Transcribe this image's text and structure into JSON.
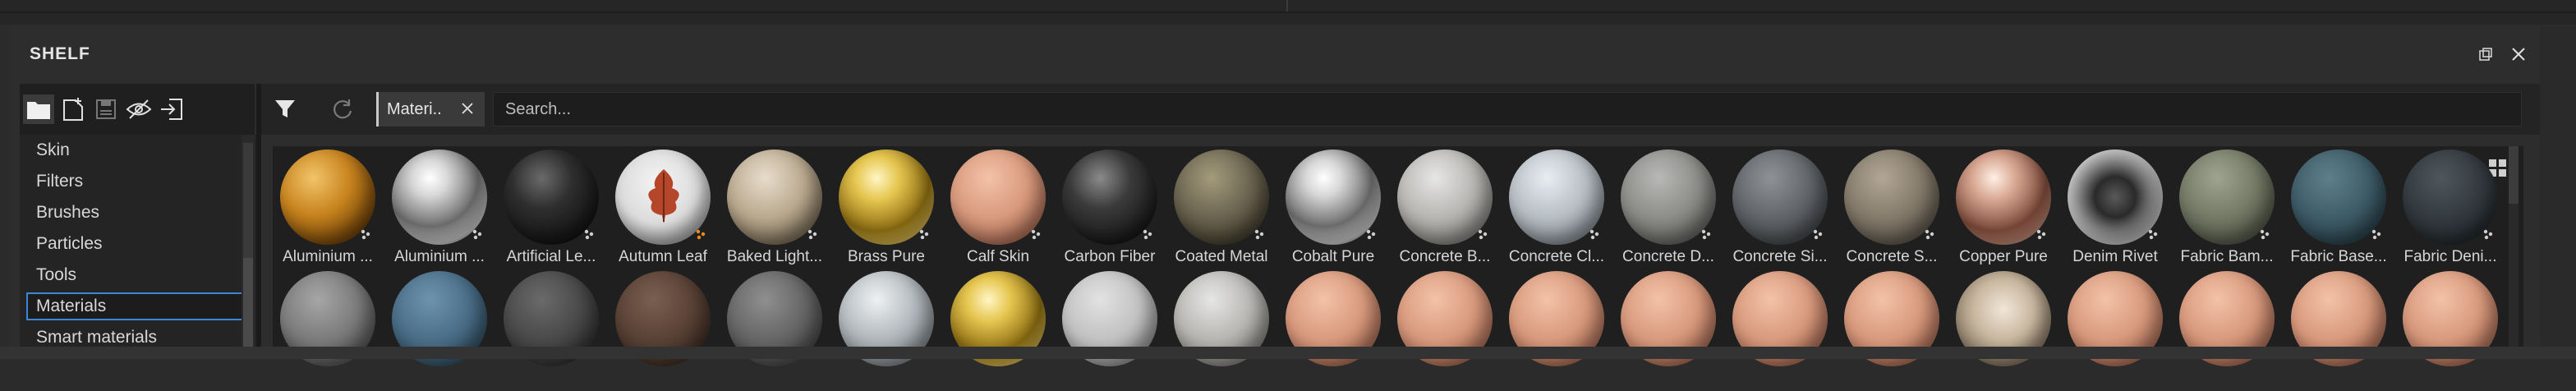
{
  "panel": {
    "title": "SHELF",
    "buttons": {
      "float": "float-window-icon",
      "close": "close-icon"
    }
  },
  "toolbar": {
    "icons": [
      "folder-icon",
      "new-resource-icon",
      "save-icon",
      "hide-icon",
      "import-icon"
    ]
  },
  "categories": {
    "items": [
      {
        "label": "Skin"
      },
      {
        "label": "Filters"
      },
      {
        "label": "Brushes"
      },
      {
        "label": "Particles"
      },
      {
        "label": "Tools"
      },
      {
        "label": "Materials",
        "selected": true
      },
      {
        "label": "Smart materials"
      }
    ]
  },
  "filter": {
    "chip_label": "Materi..",
    "search_placeholder": "Search...",
    "icons": [
      "filter-icon",
      "reset-icon"
    ]
  },
  "materials": {
    "row1": [
      {
        "label": "Aluminium ...",
        "type": "gold-dotted"
      },
      {
        "label": "Aluminium ...",
        "type": "chrome"
      },
      {
        "label": "Artificial Le...",
        "type": "black"
      },
      {
        "label": "Autumn Leaf",
        "type": "leaf"
      },
      {
        "label": "Baked Light...",
        "type": "beige"
      },
      {
        "label": "Brass Pure",
        "type": "gold"
      },
      {
        "label": "Calf Skin",
        "type": "skin"
      },
      {
        "label": "Carbon Fiber",
        "type": "carbon"
      },
      {
        "label": "Coated Metal",
        "type": "olive"
      },
      {
        "label": "Cobalt Pure",
        "type": "chrome"
      },
      {
        "label": "Concrete B...",
        "type": "concrete-light"
      },
      {
        "label": "Concrete Cl...",
        "type": "concrete-clean"
      },
      {
        "label": "Concrete D...",
        "type": "concrete-mid"
      },
      {
        "label": "Concrete Si...",
        "type": "concrete-dark"
      },
      {
        "label": "Concrete S...",
        "type": "concrete-brown"
      },
      {
        "label": "Copper Pure",
        "type": "copper"
      },
      {
        "label": "Denim Rivet",
        "type": "rivet"
      },
      {
        "label": "Fabric Bam...",
        "type": "fabric-olive"
      },
      {
        "label": "Fabric Base...",
        "type": "fabric-teal"
      },
      {
        "label": "Fabric Deni...",
        "type": "fabric-dark"
      }
    ],
    "row2": [
      {
        "type": "grey"
      },
      {
        "type": "blue"
      },
      {
        "type": "darkgrey"
      },
      {
        "type": "brown"
      },
      {
        "type": "woven"
      },
      {
        "type": "silver"
      },
      {
        "type": "gold"
      },
      {
        "type": "pale"
      },
      {
        "type": "concrete-light"
      },
      {
        "type": "skin"
      },
      {
        "type": "skin"
      },
      {
        "type": "skin"
      },
      {
        "type": "skin"
      },
      {
        "type": "skin"
      },
      {
        "type": "skin"
      },
      {
        "type": "face"
      },
      {
        "type": "skin"
      },
      {
        "type": "skin"
      },
      {
        "type": "skin"
      },
      {
        "type": "skin"
      }
    ]
  }
}
